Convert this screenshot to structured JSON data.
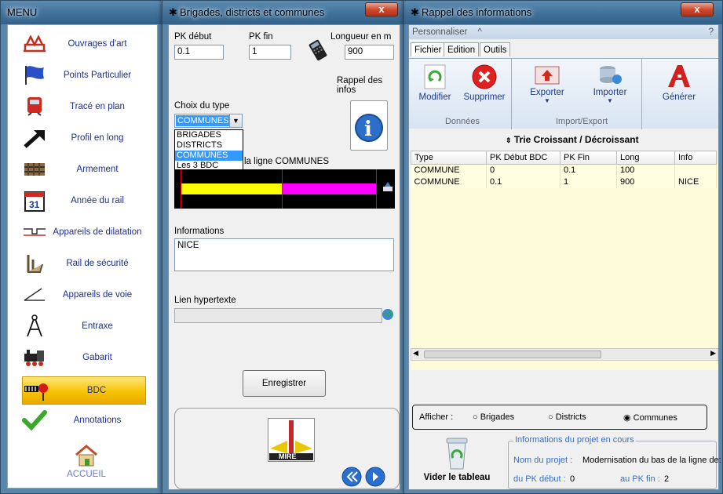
{
  "menu": {
    "title": "MENU",
    "items": [
      {
        "label": "Ouvrages d'art",
        "icon": "bridge-icon"
      },
      {
        "label": "Points Particulier",
        "icon": "flag-icon"
      },
      {
        "label": "Tracé en plan",
        "icon": "train-icon"
      },
      {
        "label": "Profil en long",
        "icon": "arrow-up-right-icon"
      },
      {
        "label": "Armement",
        "icon": "rail-tie-icon"
      },
      {
        "label": "Année du rail",
        "icon": "calendar-icon"
      },
      {
        "label": "Appareils de dilatation",
        "icon": "expansion-joint-icon"
      },
      {
        "label": "Rail de sécurité",
        "icon": "safety-rail-icon"
      },
      {
        "label": "Appareils de voie",
        "icon": "switch-icon"
      },
      {
        "label": "Entraxe",
        "icon": "compass-icon"
      },
      {
        "label": "Gabarit",
        "icon": "locomotive-icon"
      },
      {
        "label": "BDC",
        "icon": "signal-icon"
      },
      {
        "label": "Annotations",
        "icon": "checkmark-icon"
      }
    ],
    "accueil": "ACCUEIL"
  },
  "brigades": {
    "title": "Brigades, districts et communes",
    "close": "x",
    "pk_debut_label": "PK début",
    "pk_debut_value": "0.1",
    "pk_fin_label": "PK fin",
    "pk_fin_value": "1",
    "longueur_label": "Longueur en m",
    "longueur_value": "900",
    "rappel_label": "Rappel des infos",
    "choix_label": "Choix du type",
    "type_selected": "COMMUNES",
    "type_options": [
      "BRIGADES",
      "DISTRICTS",
      "COMMUNES",
      "Les 3 BDC"
    ],
    "ligne_label": "la ligne  COMMUNES",
    "informations_label": "Informations",
    "informations_value": "NICE",
    "lien_label": "Lien hypertexte",
    "lien_value": "",
    "enregistrer": "Enregistrer",
    "logo_text": "MIRE"
  },
  "rappel": {
    "title": "Rappel des informations",
    "close": "x",
    "personnaliser": "Personnaliser",
    "caret": "^",
    "help": "?",
    "tabs": [
      "Fichier",
      "Edition",
      "Outils"
    ],
    "buttons": {
      "modifier": "Modifier",
      "supprimer": "Supprimer",
      "exporter": "Exporter",
      "importer": "Importer",
      "generer": "Générer"
    },
    "groups": {
      "donnees": "Données",
      "import_export": "Import/Export"
    },
    "sort_label": "Trie Croissant / Décroissant",
    "columns": [
      "Type",
      "PK Début BDC",
      "PK Fin",
      "Long",
      "Info"
    ],
    "rows": [
      [
        "COMMUNE",
        "0",
        "0.1",
        "100",
        ""
      ],
      [
        "COMMUNE",
        "0.1",
        "1",
        "900",
        "NICE"
      ]
    ],
    "afficher_label": "Afficher :",
    "radio": [
      "Brigades",
      "Districts",
      "Communes"
    ],
    "radio_selected": "Communes",
    "vider": "Vider le tableau",
    "projet_title": "Informations du projet en cours",
    "nom_label": "Nom du projet :",
    "nom_value": "Modernisation du bas de la ligne de:",
    "pk_debut_label": "du PK début :",
    "pk_debut_value": "0",
    "pk_fin_label": "au PK fin :",
    "pk_fin_value": "2"
  },
  "colors": {
    "accent": "#3399ff",
    "title_bar": "#4a7ba3",
    "grid_bg": "#fffee0",
    "bar_yellow": "#ffff00",
    "bar_magenta": "#ff00ff"
  }
}
